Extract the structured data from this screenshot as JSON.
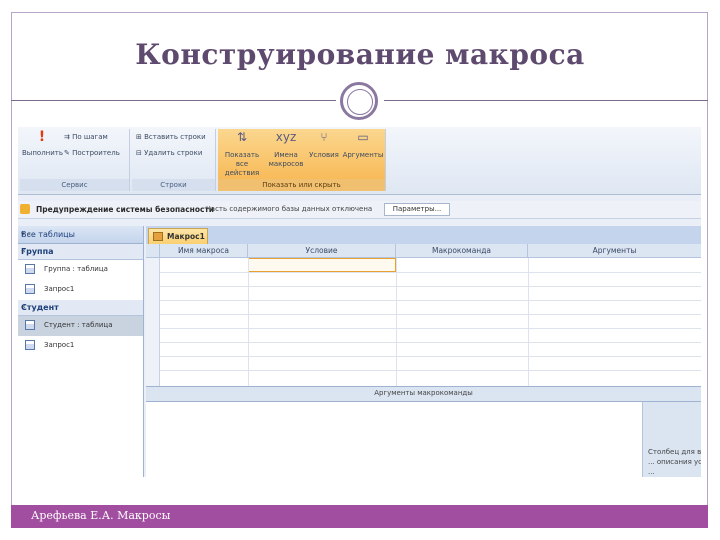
{
  "slide": {
    "title": "Конструирование макроса",
    "footer": "Арефьева Е.А. Макросы"
  },
  "ribbon": {
    "groups": [
      {
        "name": "Сервис",
        "run_label": "Выполнить",
        "items": [
          "По шагам",
          "Построитель"
        ]
      },
      {
        "name": "Строки",
        "items": [
          "Вставить строки",
          "Удалить строки"
        ]
      },
      {
        "name": "Показать или скрыть",
        "buttons": [
          "Показать все действия",
          "Имена макросов",
          "Условия",
          "Аргументы"
        ]
      }
    ]
  },
  "security_bar": {
    "title": "Предупреждение системы безопасности",
    "text": "Часть содержимого базы данных отключена",
    "button": "Параметры..."
  },
  "nav_pane": {
    "header": "Все таблицы",
    "groups": [
      {
        "name": "Группа",
        "items": [
          "Группа : таблица",
          "Запрос1"
        ]
      },
      {
        "name": "Студент",
        "items": [
          "Студент : таблица",
          "Запрос1"
        ]
      }
    ]
  },
  "macro": {
    "tab_name": "Макрос1",
    "columns": [
      "Имя макроса",
      "Условие",
      "Макрокоманда",
      "Аргументы"
    ],
    "arguments_header": "Аргументы макрокоманды",
    "hint": "Столбец для в ... описания усл ..."
  }
}
